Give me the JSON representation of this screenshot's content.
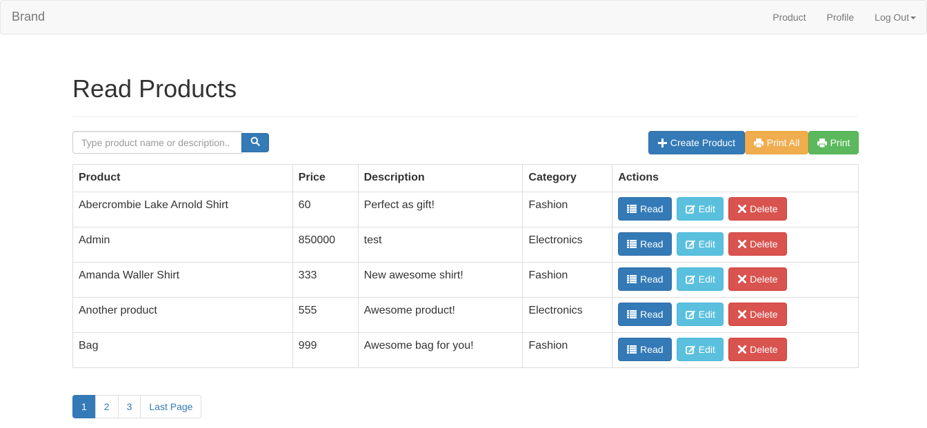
{
  "navbar": {
    "brand": "Brand",
    "links": {
      "product": "Product",
      "profile": "Profile",
      "logout": "Log Out"
    }
  },
  "page": {
    "title": "Read Products"
  },
  "search": {
    "placeholder": "Type product name or description..",
    "icon": "search-icon"
  },
  "toolbar": {
    "create_label": "Create Product",
    "print_all_label": "Print All",
    "print_label": "Print"
  },
  "table": {
    "headers": {
      "product": "Product",
      "price": "Price",
      "description": "Description",
      "category": "Category",
      "actions": "Actions"
    },
    "rows": [
      {
        "product": "Abercrombie Lake Arnold Shirt",
        "price": "60",
        "description": "Perfect as gift!",
        "category": "Fashion"
      },
      {
        "product": "Admin",
        "price": "850000",
        "description": "test",
        "category": "Electronics"
      },
      {
        "product": "Amanda Waller Shirt",
        "price": "333",
        "description": "New awesome shirt!",
        "category": "Fashion"
      },
      {
        "product": "Another product",
        "price": "555",
        "description": "Awesome product!",
        "category": "Electronics"
      },
      {
        "product": "Bag",
        "price": "999",
        "description": "Awesome bag for you!",
        "category": "Fashion"
      }
    ],
    "row_actions": {
      "read": "Read",
      "edit": "Edit",
      "delete": "Delete"
    }
  },
  "pagination": {
    "pages": [
      "1",
      "2",
      "3"
    ],
    "last": "Last Page",
    "active": "1"
  },
  "colors": {
    "primary": "#337ab7",
    "warning": "#f0ad4e",
    "success": "#5cb85c",
    "info": "#5bc0de",
    "danger": "#d9534f"
  }
}
